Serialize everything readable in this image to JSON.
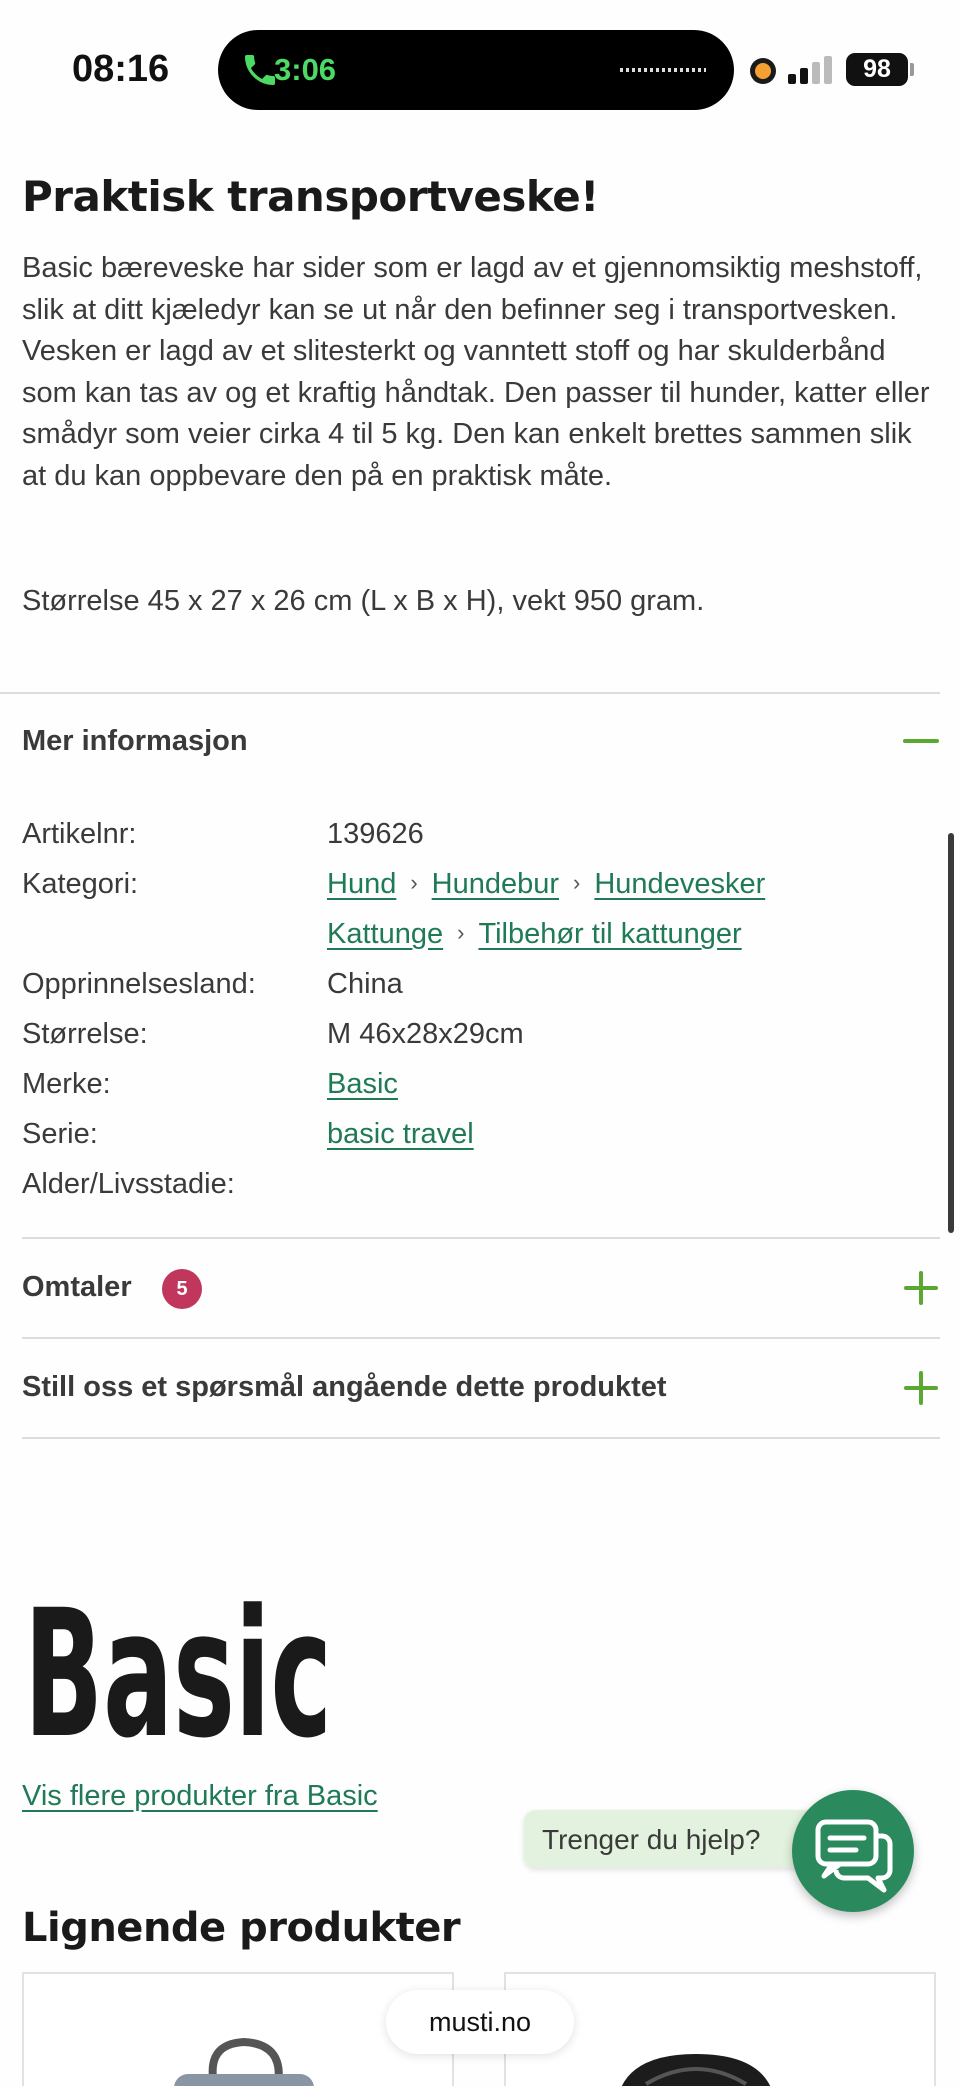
{
  "status_bar": {
    "time": "08:16",
    "call_duration": "3:06",
    "battery": "98",
    "call_color": "#4cd964"
  },
  "description": {
    "title": "Praktisk transportveske!",
    "text": "Basic bæreveske har sider som er lagd av et gjennomsiktig meshstoff, slik at ditt kjæledyr kan se ut når den befinner seg i transportvesken. Vesken er lagd av et slitesterkt og vanntett stoff og har skulderbånd som kan tas av og et kraftig håndtak. Den passer til hunder, katter eller smådyr som veier cirka 4 til 5 kg. Den kan enkelt brettes sammen slik at du kan oppbevare den på en praktisk måte.",
    "size_text": "Størrelse 45 x 27 x 26 cm (L x B x H), vekt 950 gram."
  },
  "more_info": {
    "title": "Mer informasjon",
    "rows": {
      "article_label": "Artikelnr:",
      "article_value": "139626",
      "category_label": "Kategori:",
      "category_line1": [
        "Hund",
        "Hundebur",
        "Hundevesker"
      ],
      "category_line2": [
        "Kattunge",
        "Tilbehør til kattunger"
      ],
      "origin_label": "Opprinnelsesland:",
      "origin_value": "China",
      "size_label": "Størrelse:",
      "size_value": "M 46x28x29cm",
      "brand_label": "Merke:",
      "brand_value": "Basic",
      "series_label": "Serie:",
      "series_value": "basic travel",
      "age_label": "Alder/Livsstadie:"
    }
  },
  "reviews": {
    "title": "Omtaler",
    "count": "5"
  },
  "questions": {
    "title": "Still oss et spørsmål angående dette produktet"
  },
  "brand": {
    "logo_text": "Basic",
    "link": "Vis flere produkter fra Basic"
  },
  "similar": {
    "title": "Lignende produkter"
  },
  "help": {
    "text": "Trenger du hjelp?"
  },
  "url_bar": {
    "domain": "musti.no"
  },
  "colors": {
    "accent_green": "#5aa832",
    "link_green": "#1f7a55",
    "badge": "#c0365c",
    "chat_button": "#2a8a5e"
  }
}
